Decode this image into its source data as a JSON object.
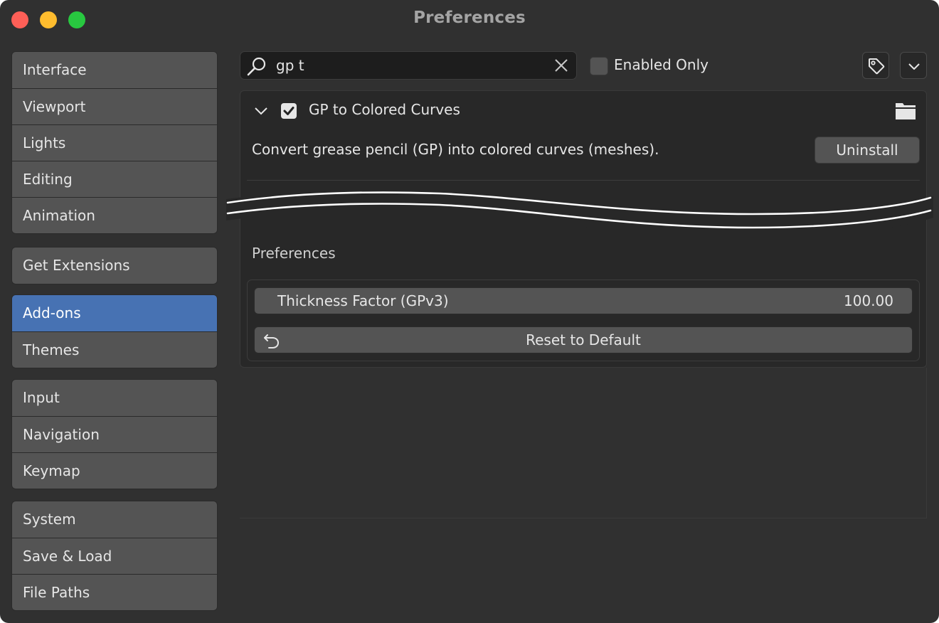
{
  "window": {
    "title": "Preferences"
  },
  "sidebar": {
    "groups": [
      {
        "items": [
          {
            "label": "Interface"
          },
          {
            "label": "Viewport"
          },
          {
            "label": "Lights"
          },
          {
            "label": "Editing"
          },
          {
            "label": "Animation"
          }
        ]
      },
      {
        "items": [
          {
            "label": "Get Extensions"
          }
        ]
      },
      {
        "items": [
          {
            "label": "Add-ons",
            "active": true
          },
          {
            "label": "Themes"
          }
        ]
      },
      {
        "items": [
          {
            "label": "Input"
          },
          {
            "label": "Navigation"
          },
          {
            "label": "Keymap"
          }
        ]
      },
      {
        "items": [
          {
            "label": "System"
          },
          {
            "label": "Save & Load"
          },
          {
            "label": "File Paths"
          }
        ]
      }
    ]
  },
  "topbar": {
    "search": {
      "value": "gp t",
      "icon": "search-icon",
      "clear_icon": "close-icon"
    },
    "enabled_only": {
      "label": "Enabled Only",
      "checked": false
    },
    "tag_icon": "tag-icon",
    "menu_icon": "chevron-down-icon"
  },
  "addon": {
    "name": "GP to Colored Curves",
    "enabled": true,
    "expanded": true,
    "description": "Convert grease pencil (GP) into colored curves (meshes).",
    "uninstall_label": "Uninstall",
    "preferences_label": "Preferences",
    "thickness": {
      "label": "Thickness Factor (GPv3)",
      "value": "100.00"
    },
    "reset_label": "Reset to Default"
  },
  "colors": {
    "window_bg": "#303030",
    "panel_bg": "#282828",
    "button_bg": "#545454",
    "accent": "#4772b3",
    "text": "#e6e6e6"
  }
}
